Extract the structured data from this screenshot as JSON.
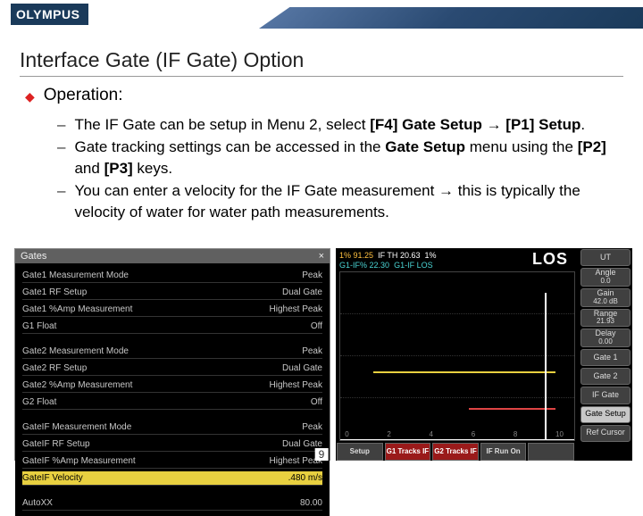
{
  "brand": {
    "logo": "OLYMPUS"
  },
  "title": "Interface Gate (IF Gate) Option",
  "operation": {
    "heading": "Operation:",
    "items": [
      {
        "pre": "The IF Gate can be setup in Menu 2, select ",
        "k1": "[F4] Gate Setup",
        "mid": " → ",
        "k2": "[P1] Setup",
        "post": "."
      },
      {
        "pre": "Gate tracking settings can be accessed in the ",
        "k1": "Gate Setup",
        "mid": " menu using the ",
        "k2": "[P2]",
        "mid2": " and ",
        "k3": "[P3]",
        "post": " keys."
      },
      {
        "pre": "You can enter a velocity for the IF Gate measurement → this is typically the velocity of water for water path measurements."
      }
    ]
  },
  "dialog": {
    "title": "Gates",
    "close": "×",
    "rows": [
      {
        "lab": "Gate1 Measurement Mode",
        "val": "Peak"
      },
      {
        "lab": "Gate1 RF Setup",
        "val": "Dual Gate"
      },
      {
        "lab": "Gate1 %Amp Measurement",
        "val": "Highest Peak"
      },
      {
        "lab": "G1 Float",
        "val": "Off"
      },
      {
        "lab": "",
        "val": "",
        "spacer": true
      },
      {
        "lab": "Gate2 Measurement Mode",
        "val": "Peak"
      },
      {
        "lab": "Gate2 RF Setup",
        "val": "Dual Gate"
      },
      {
        "lab": "Gate2 %Amp Measurement",
        "val": "Highest Peak"
      },
      {
        "lab": "G2 Float",
        "val": "Off"
      },
      {
        "lab": "",
        "val": "",
        "spacer": true
      },
      {
        "lab": "GateIF Measurement Mode",
        "val": "Peak"
      },
      {
        "lab": "GateIF RF Setup",
        "val": "Dual Gate"
      },
      {
        "lab": "GateIF %Amp Measurement",
        "val": "Highest Peak"
      },
      {
        "lab": "GateIF Velocity",
        "val": ".480     m/s",
        "sel": true
      },
      {
        "lab": "",
        "val": "",
        "spacer": true
      },
      {
        "lab": "AutoXX",
        "val": "80.00"
      }
    ]
  },
  "instr": {
    "readouts": {
      "l1a": "1%",
      "l1b": "91.25",
      "l1c": "IF TH",
      "l1d": "20.63",
      "l2a": "G1-IF%",
      "l2b": "22.30",
      "l2c": "G1-IF",
      "l2d": "LOS",
      "pct": "1%"
    },
    "los": "LOS",
    "right": [
      {
        "lab": "UT",
        "sub": ""
      },
      {
        "lab": "Angle",
        "sub": "0.0"
      },
      {
        "lab": "Gain",
        "sub": "42.0 dB"
      },
      {
        "lab": "Range",
        "sub": "21.93"
      },
      {
        "lab": "Delay",
        "sub": "0.00"
      },
      {
        "lab": "Gate 1",
        "sub": ""
      },
      {
        "lab": "Gate 2",
        "sub": ""
      },
      {
        "lab": "IF Gate",
        "sub": ""
      },
      {
        "lab": "Gate Setup",
        "sub": "",
        "sel": true
      },
      {
        "lab": "Ref Cursor",
        "sub": ""
      }
    ],
    "bottom": [
      {
        "t": "Setup"
      },
      {
        "t": "G1 Tracks\nIF",
        "red": true
      },
      {
        "t": "G2 Tracks\nIF",
        "red": true
      },
      {
        "t": "IF Run\nOn"
      },
      {
        "t": ""
      }
    ],
    "xticks": [
      "0",
      "2",
      "4",
      "6",
      "8",
      "10"
    ]
  },
  "page": "9"
}
